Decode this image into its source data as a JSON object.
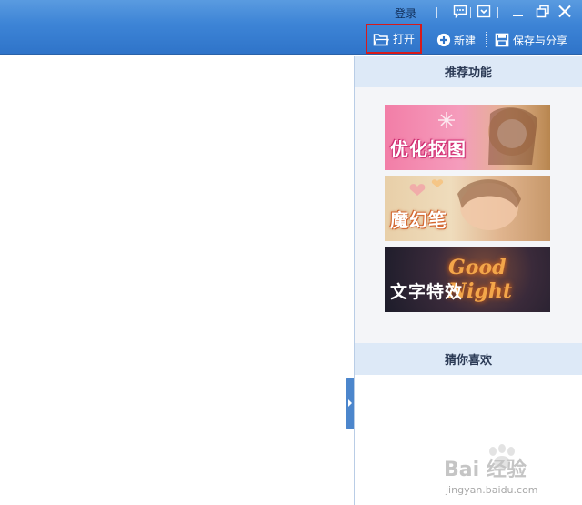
{
  "header": {
    "login_label": "登录",
    "open_label": "打开",
    "new_label": "新建",
    "save_share_label": "保存与分享"
  },
  "panel": {
    "recommended_title": "推荐功能",
    "guess_title": "猜你喜欢",
    "banners": [
      {
        "label": "优化抠图",
        "icon": "snowflake-decor"
      },
      {
        "label": "魔幻笔",
        "icon": "heart-decor"
      },
      {
        "label": "文字特效",
        "script_text": "Good Night"
      }
    ]
  },
  "watermark": {
    "logo": "Bai 经验",
    "url": "jingyan.baidu.com"
  },
  "colors": {
    "titlebar": "#3d84d6",
    "highlight_border": "#d81a1a",
    "panel_header": "#dde9f7",
    "panel_bg": "#f4f5f8"
  }
}
